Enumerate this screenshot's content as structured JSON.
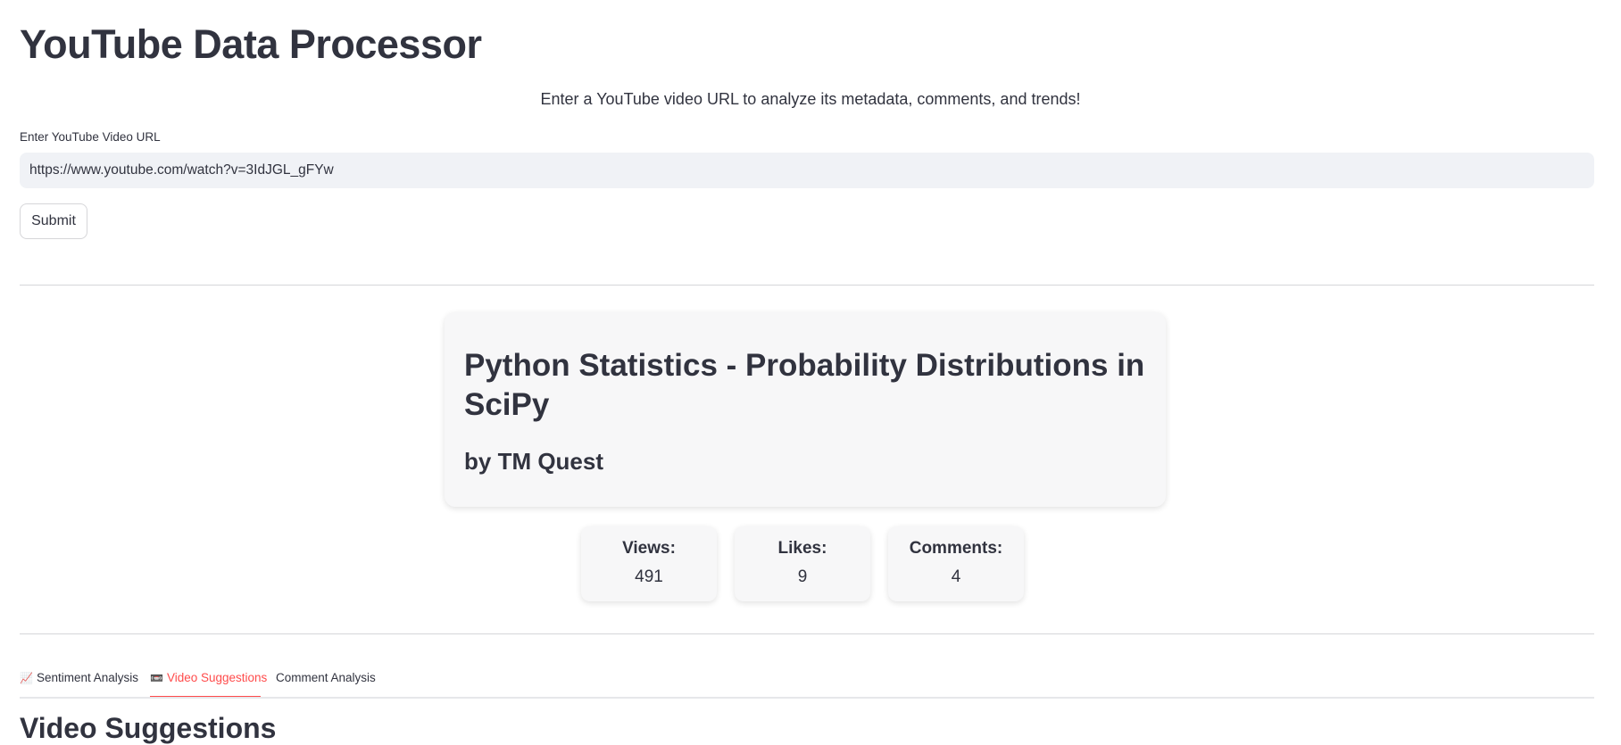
{
  "app": {
    "title": "YouTube Data Processor",
    "subtitle": "Enter a YouTube video URL to analyze its metadata, comments, and trends!"
  },
  "form": {
    "url_label": "Enter YouTube Video URL",
    "url_value": "https://www.youtube.com/watch?v=3IdJGL_gFYw",
    "submit_label": "Submit"
  },
  "video": {
    "title": "Python Statistics - Probability Distributions in SciPy",
    "channel": "by TM Quest"
  },
  "stats": {
    "views_label": "Views:",
    "views_value": "491",
    "likes_label": "Likes:",
    "likes_value": "9",
    "comments_label": "Comments:",
    "comments_value": "4"
  },
  "tabs": [
    {
      "icon": "chart-increasing-icon",
      "glyph": "📈",
      "label": "Sentiment Analysis",
      "active": false
    },
    {
      "icon": "video-icon",
      "glyph": "📼",
      "label": "Video Suggestions",
      "active": true
    },
    {
      "icon": "",
      "glyph": "",
      "label": "Comment Analysis",
      "active": false
    }
  ],
  "section": {
    "heading": "Video Suggestions"
  },
  "colors": {
    "accent": "#ff4b4b",
    "input_bg": "#f0f2f6",
    "card_bg": "#f7f7f8",
    "text": "#31333f"
  }
}
